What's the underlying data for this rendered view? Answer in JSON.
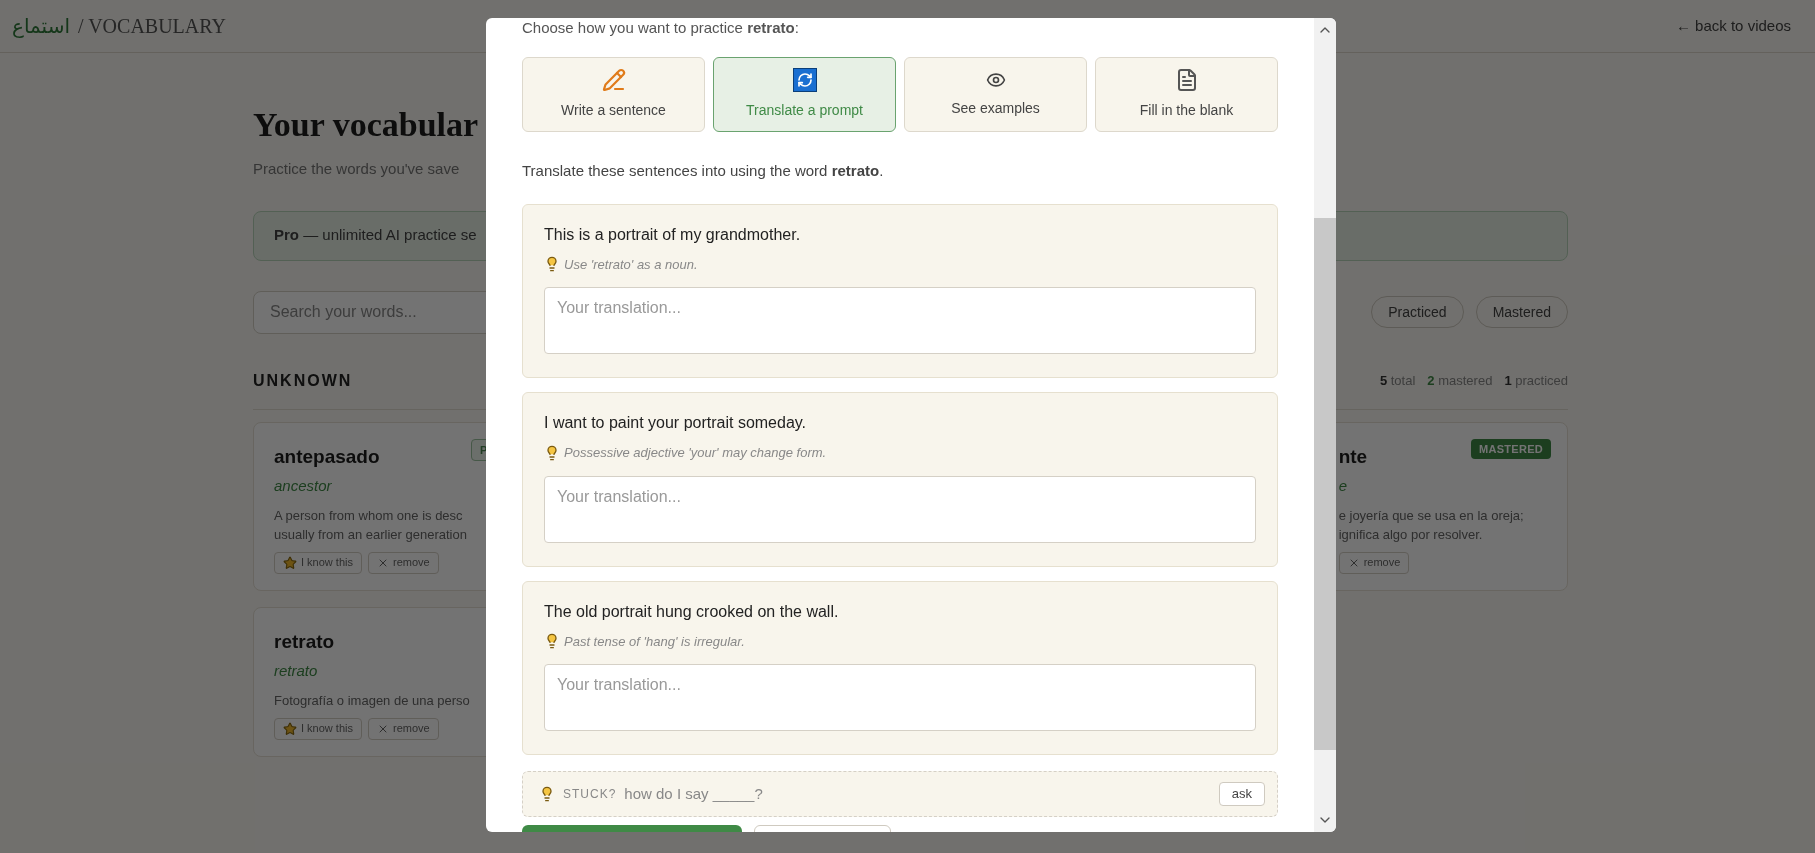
{
  "header": {
    "logo": "استماع",
    "section": "/ VOCABULARY",
    "back_link": "← back to videos"
  },
  "page": {
    "title": "Your vocabular",
    "subtitle": "Practice the words you've save",
    "banner": "**Pro** — unlimited AI practice se"
  },
  "search": {
    "placeholder": "Search your words..."
  },
  "filters": [
    {
      "label": "Practiced",
      "selected": false
    },
    {
      "label": "Mastered",
      "selected": false
    }
  ],
  "section": {
    "title": "UNKNOWN",
    "stats": [
      {
        "count": "5",
        "label": "total",
        "highlight": false
      },
      {
        "count": "2",
        "label": "mastered",
        "highlight": true
      },
      {
        "count": "1",
        "label": "practiced",
        "highlight": false
      }
    ]
  },
  "cards_left": [
    {
      "word": "antepasado",
      "translation": "ancestor",
      "definition_lines": [
        "A person from whom one is desc",
        "usually from an earlier generation"
      ],
      "badge": {
        "kind": "practiced",
        "text": "P"
      },
      "actions": [
        {
          "kind": "know",
          "label": "I know this"
        },
        {
          "kind": "remove",
          "label": "remove"
        }
      ]
    },
    {
      "word": "retrato",
      "translation": "retrato",
      "definition_lines": [
        "Fotografía o imagen de una perso"
      ],
      "actions": [
        {
          "kind": "know",
          "label": "I know this"
        },
        {
          "kind": "remove",
          "label": "remove"
        }
      ]
    }
  ],
  "cards_right": [
    {
      "word": "nte",
      "translation": "e",
      "definition_lines": [
        "e joyería que se usa en la oreja;",
        "ignifica algo por resolver."
      ],
      "badge": {
        "kind": "mastered",
        "text": "MASTERED"
      },
      "actions": [
        {
          "kind": "remove",
          "label": "remove"
        }
      ]
    }
  ],
  "modal": {
    "intro": "Choose how you want to practice **retrato**:",
    "options": [
      {
        "kind": "write",
        "label": "Write a sentence",
        "selected": false
      },
      {
        "kind": "translate",
        "label": "Translate a prompt",
        "selected": true
      },
      {
        "kind": "examples",
        "label": "See examples",
        "selected": false
      },
      {
        "kind": "blank",
        "label": "Fill in the blank",
        "selected": false
      }
    ],
    "instruction": "Translate these sentences into using the word **retrato**.",
    "prompts": [
      {
        "sentence": "This is a portrait of my grandmother.",
        "hint": "Use 'retrato' as a noun.",
        "placeholder": "Your translation..."
      },
      {
        "sentence": "I want to paint your portrait someday.",
        "hint": "Possessive adjective 'your' may change form.",
        "placeholder": "Your translation..."
      },
      {
        "sentence": "The old portrait hung crooked on the wall.",
        "hint": "Past tense of 'hang' is irregular.",
        "placeholder": "Your translation..."
      }
    ],
    "stuck": {
      "label": "STUCK?",
      "placeholder": "how do I say _____?",
      "button": "ask"
    }
  }
}
